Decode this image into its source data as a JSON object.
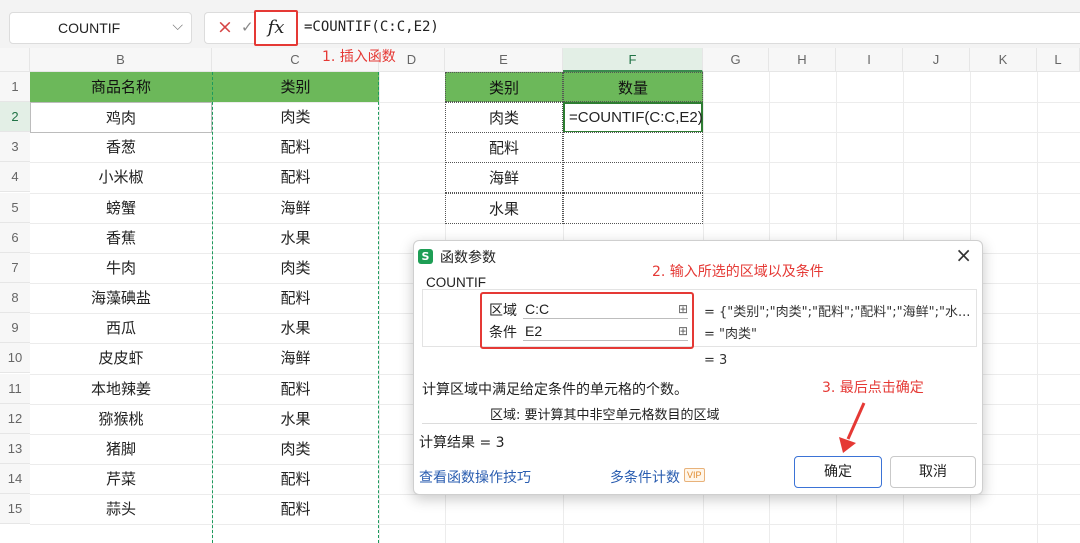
{
  "formula_bar": {
    "name_box": "COUNTIF",
    "cancel_icon": "×",
    "confirm_icon": "✓",
    "fx_label": "fx",
    "formula": "=COUNTIF(C:C,E2)",
    "annotation": "1. 插入函数"
  },
  "sheet": {
    "columns": [
      "B",
      "C",
      "D",
      "E",
      "F",
      "G",
      "H",
      "I",
      "J",
      "K",
      "L"
    ],
    "active_column": "F",
    "rows": [
      "1",
      "2",
      "3",
      "4",
      "5",
      "6",
      "7",
      "8",
      "9",
      "10",
      "11",
      "12",
      "13",
      "14",
      "15"
    ],
    "active_row": "2",
    "header_fill": "#6cb85a",
    "table1": {
      "headers": [
        "商品名称",
        "类别"
      ],
      "rows": [
        [
          "鸡肉",
          "肉类"
        ],
        [
          "香葱",
          "配料"
        ],
        [
          "小米椒",
          "配料"
        ],
        [
          "螃蟹",
          "海鲜"
        ],
        [
          "香蕉",
          "水果"
        ],
        [
          "牛肉",
          "肉类"
        ],
        [
          "海藻碘盐",
          "配料"
        ],
        [
          "西瓜",
          "水果"
        ],
        [
          "皮皮虾",
          "海鲜"
        ],
        [
          "本地辣姜",
          "配料"
        ],
        [
          "猕猴桃",
          "水果"
        ],
        [
          "猪脚",
          "肉类"
        ],
        [
          "芹菜",
          "配料"
        ],
        [
          "蒜头",
          "配料"
        ]
      ]
    },
    "table2": {
      "headers": [
        "类别",
        "数量"
      ],
      "categories": [
        "肉类",
        "配料",
        "海鲜",
        "水果"
      ],
      "editing_formula": "=COUNTIF(C:C,E2)"
    }
  },
  "dialog": {
    "logo": "S",
    "title": "函数参数",
    "close_icon": "×",
    "annotation2": "2. 输入所选的区域以及条件",
    "function_name": "COUNTIF",
    "args": [
      {
        "label": "区域",
        "value": "C:C",
        "result": "= {\"类别\";\"肉类\";\"配料\";\"配料\";\"海鲜\";\"水..."
      },
      {
        "label": "条件",
        "value": "E2",
        "result": "= \"肉类\""
      }
    ],
    "result_line": "= 3",
    "description": "计算区域中满足给定条件的单元格的个数。",
    "param_desc": "区域:  要计算其中非空单元格数目的区域",
    "calc_result": "计算结果 = 3",
    "annotation3": "3. 最后点击确定",
    "tips_link": "查看函数操作技巧",
    "multi_link": "多条件计数",
    "vip_badge": "VIP",
    "ok_label": "确定",
    "cancel_label": "取消"
  }
}
